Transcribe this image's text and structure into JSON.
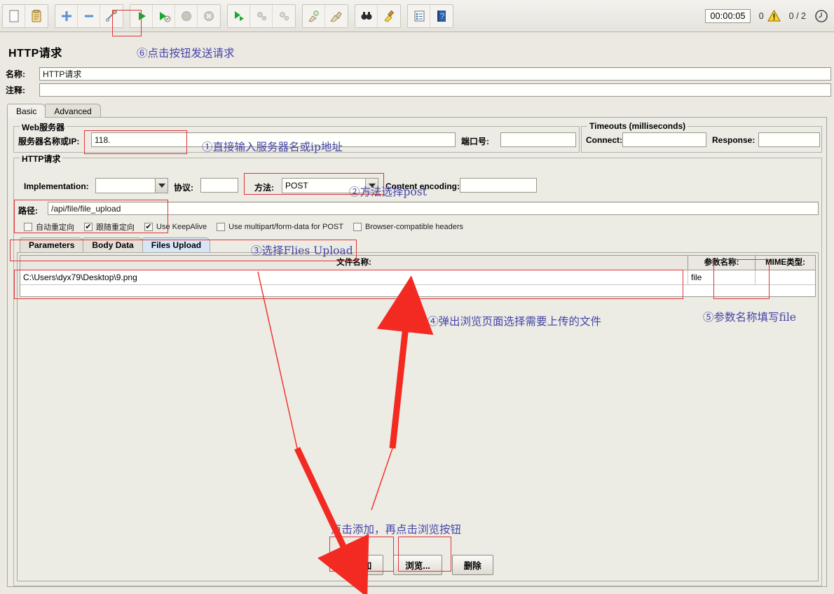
{
  "toolbar": {
    "icons": [
      {
        "name": "new-icon"
      },
      {
        "name": "templates-icon"
      },
      {
        "name": "open-icon"
      },
      {
        "name": "save-icon"
      },
      {
        "name": "cut-icon"
      },
      {
        "name": "start-icon"
      },
      {
        "name": "start-no-pauses-icon"
      },
      {
        "name": "stop-icon"
      },
      {
        "name": "shutdown-icon"
      },
      {
        "name": "start-remote-icon"
      },
      {
        "name": "stop-remote-icon"
      },
      {
        "name": "shutdown-remote-icon"
      },
      {
        "name": "clear-icon"
      },
      {
        "name": "clear-all-icon"
      },
      {
        "name": "search-icon"
      },
      {
        "name": "reset-search-icon"
      },
      {
        "name": "function-helper-icon"
      },
      {
        "name": "help-icon"
      }
    ],
    "timer": "00:00:05",
    "warning_count": "0",
    "thread_count": "0 / 2",
    "warning_icon": "warning-triangle-icon",
    "clock_icon": "clock-icon"
  },
  "header": {
    "title": "HTTP请求",
    "name_label": "名称:",
    "name_value": "HTTP请求",
    "comment_label": "注释:",
    "comment_value": ""
  },
  "tabs": [
    {
      "label": "Basic",
      "active": true
    },
    {
      "label": "Advanced",
      "active": false
    }
  ],
  "web_server": {
    "legend": "Web服务器",
    "host_label": "服务器名称或IP:",
    "host_value": "118.",
    "port_label": "端口号:",
    "port_value": ""
  },
  "timeouts": {
    "legend": "Timeouts (milliseconds)",
    "connect_label": "Connect:",
    "connect_value": "",
    "response_label": "Response:",
    "response_value": ""
  },
  "http_request": {
    "legend": "HTTP请求",
    "implementation_label": "Implementation:",
    "implementation_value": "",
    "protocol_label": "协议:",
    "protocol_value": "",
    "method_label": "方法:",
    "method_value": "POST",
    "content_encoding_label": "Content encoding:",
    "content_encoding_value": "",
    "path_label": "路径:",
    "path_value": "/api/file/file_upload",
    "checkboxes": [
      {
        "label": "自动重定向",
        "checked": false
      },
      {
        "label": "跟随重定向",
        "checked": true
      },
      {
        "label": "Use KeepAlive",
        "checked": true
      },
      {
        "label": "Use multipart/form-data for POST",
        "checked": false
      },
      {
        "label": "Browser-compatible headers",
        "checked": false
      }
    ]
  },
  "inner_tabs": [
    {
      "label": "Parameters",
      "active": false
    },
    {
      "label": "Body Data",
      "active": false
    },
    {
      "label": "Files Upload",
      "active": true
    }
  ],
  "file_table": {
    "columns": [
      "文件名称:",
      "参数名称:",
      "MIME类型:"
    ],
    "rows": [
      {
        "file": "C:\\Users\\dyx79\\Desktop\\9.png",
        "param": "file",
        "mime": ""
      }
    ]
  },
  "buttons": {
    "add": "添加",
    "browse": "浏览...",
    "delete": "删除"
  },
  "annotations": {
    "a6": "⑥点击按钮发送请求",
    "a1": "①直接输入服务器名或ip地址",
    "a2": "②方法选择post",
    "a3": "③选择Flies Upload",
    "a4": "④弹出浏览页面选择需要上传的文件",
    "a5": "⑤参数名称填写file",
    "a_bottom": "点击添加，再点击浏览按钮"
  },
  "colors": {
    "annotation": "#4545a8",
    "highlight": "#e0353a",
    "arrow": "#f22a22",
    "active_tab": "#d6e6f7",
    "panel_bg": "#ecebe4"
  }
}
